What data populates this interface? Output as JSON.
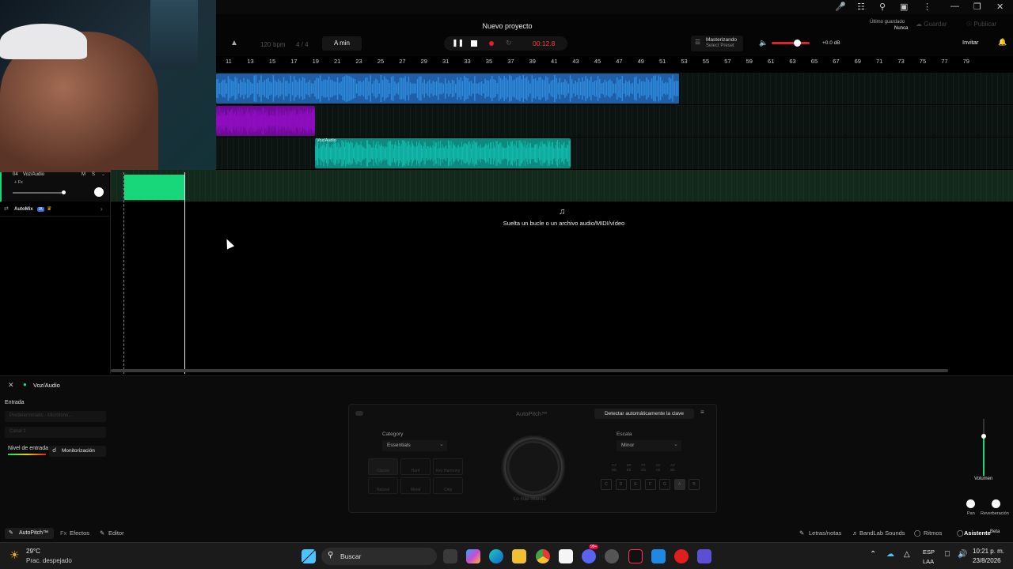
{
  "project": {
    "title": "Nuevo proyecto"
  },
  "header": {
    "last_saved_label": "Último guardado",
    "last_saved_value": "Nunca",
    "save_label": "Guardar",
    "publish_label": "Publicar",
    "invite_label": "Invitar"
  },
  "transport": {
    "bpm_value": "120",
    "bpm_unit": "bpm",
    "time_signature": "4 / 4",
    "key": "A min",
    "time_display": "00:12.8",
    "mastering_title": "Masterizando",
    "mastering_preset": "Select Preset",
    "volume_db": "+0.0 dB"
  },
  "ruler": {
    "bars": [
      "11",
      "13",
      "15",
      "17",
      "19",
      "21",
      "23",
      "25",
      "27",
      "29",
      "31",
      "33",
      "35",
      "37",
      "39",
      "41",
      "43",
      "45",
      "47",
      "49",
      "51",
      "53",
      "55",
      "57",
      "59",
      "61",
      "63",
      "65",
      "67",
      "69",
      "71",
      "73",
      "75",
      "77",
      "79"
    ]
  },
  "tracks": [
    {
      "clip_label": "",
      "color": "#2f8de0"
    },
    {
      "clip_label": "",
      "color": "#a010d6"
    },
    {
      "clip_label": "Voz/Audio",
      "color": "#14c4b4"
    },
    {
      "number": "04",
      "name": "Voz/Audio",
      "mute": "M",
      "solo": "S",
      "fx": "+ Fx",
      "color": "#16d87a"
    }
  ],
  "automix": {
    "label": "AutoMix",
    "badge": "IA"
  },
  "dropzone": {
    "text": "Suelta un bucle o un archivo audio/MIDI/vídeo"
  },
  "bottom": {
    "track_name": "Voz/Audio",
    "input_label": "Entrada",
    "input_device": "Predeterminado - Micrófono...",
    "channel": "Canal 1",
    "input_level_label": "Nivel de entrada",
    "monitor_label": "Monitorización",
    "plugin_title": "AutoPitch™",
    "detect_key": "Detectar automáticamente la clave",
    "category_label": "Category",
    "category_value": "Essentials",
    "presets": [
      "Classic",
      "Hard",
      "Key Harmony",
      "Natural",
      "Metal",
      "Chip"
    ],
    "knob_caption": "Lo más intenso",
    "scale_label": "Escala",
    "scale_value": "Minor",
    "sharp_keys": [
      "C#\nDb",
      "D#\nEb",
      "F#\nGb",
      "G#\nAb",
      "A#\nBb"
    ],
    "natural_keys": [
      "C",
      "D",
      "E",
      "F",
      "G",
      "A",
      "B"
    ],
    "volume_label": "Volumen",
    "pan_label": "Pan",
    "reverb_label": "Reverberación"
  },
  "tabs": {
    "autopitch": "AutoPitch™",
    "effects": "Efectos",
    "editor": "Editor",
    "lyrics": "Letras/notas",
    "sounds": "BandLab Sounds",
    "beats": "Ritmos",
    "assistant": "Asistente",
    "assistant_badge": "Beta"
  },
  "taskbar": {
    "temperature": "29°C",
    "weather": "Prac. despejado",
    "search_placeholder": "Buscar",
    "lang": "ESP",
    "layout": "LAA",
    "time": "10:21 p. m.",
    "date": "23/8/2026",
    "discord_badge": "99+"
  },
  "colors": {
    "track1": "#2f8de0",
    "track2": "#a010d6",
    "track3": "#14c4b4",
    "track4": "#16d87a",
    "record": "#e0202a",
    "time": "#ff3b3b"
  }
}
